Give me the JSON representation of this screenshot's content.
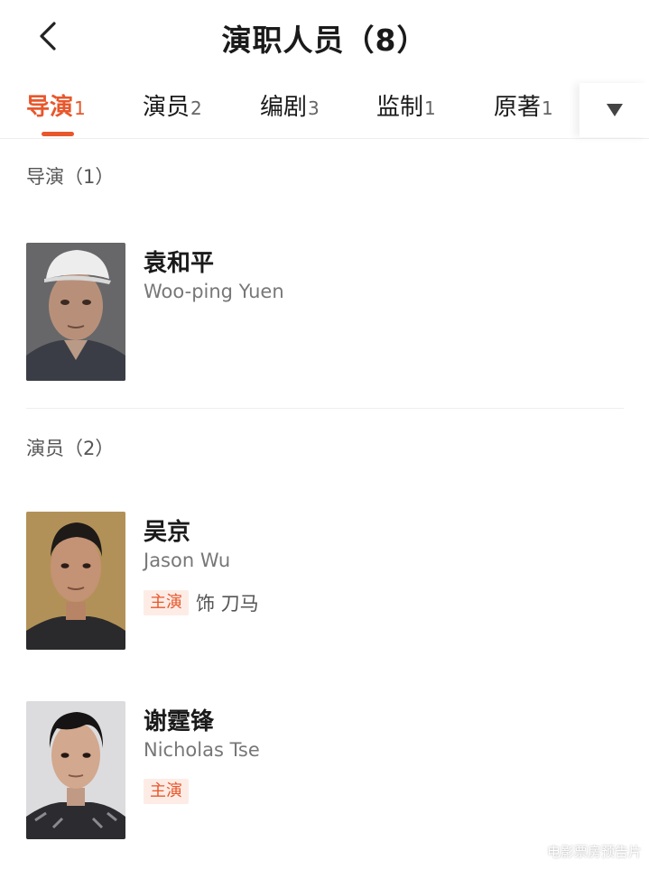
{
  "header": {
    "title": "演职人员（8）",
    "back_icon": "chevron-left-icon"
  },
  "tabs": [
    {
      "label": "导演",
      "count": "1",
      "active": true
    },
    {
      "label": "演员",
      "count": "2",
      "active": false
    },
    {
      "label": "编剧",
      "count": "3",
      "active": false
    },
    {
      "label": "监制",
      "count": "1",
      "active": false
    },
    {
      "label": "原著",
      "count": "1",
      "active": false
    }
  ],
  "tabs_more_icon": "triangle-down-icon",
  "sections": [
    {
      "title": "导演（1）",
      "people": [
        {
          "name": "袁和平",
          "name_en": "Woo-ping Yuen"
        }
      ]
    },
    {
      "title": "演员（2）",
      "people": [
        {
          "name": "吴京",
          "name_en": "Jason Wu",
          "badge": "主演",
          "character": "饰 刀马"
        },
        {
          "name": "谢霆锋",
          "name_en": "Nicholas Tse",
          "badge": "主演"
        }
      ]
    }
  ],
  "watermark": "电影票房预告片",
  "colors": {
    "accent": "#e8572c",
    "badge_bg": "#fdece6",
    "divider": "#eeeeee",
    "secondary_text": "#777777"
  }
}
